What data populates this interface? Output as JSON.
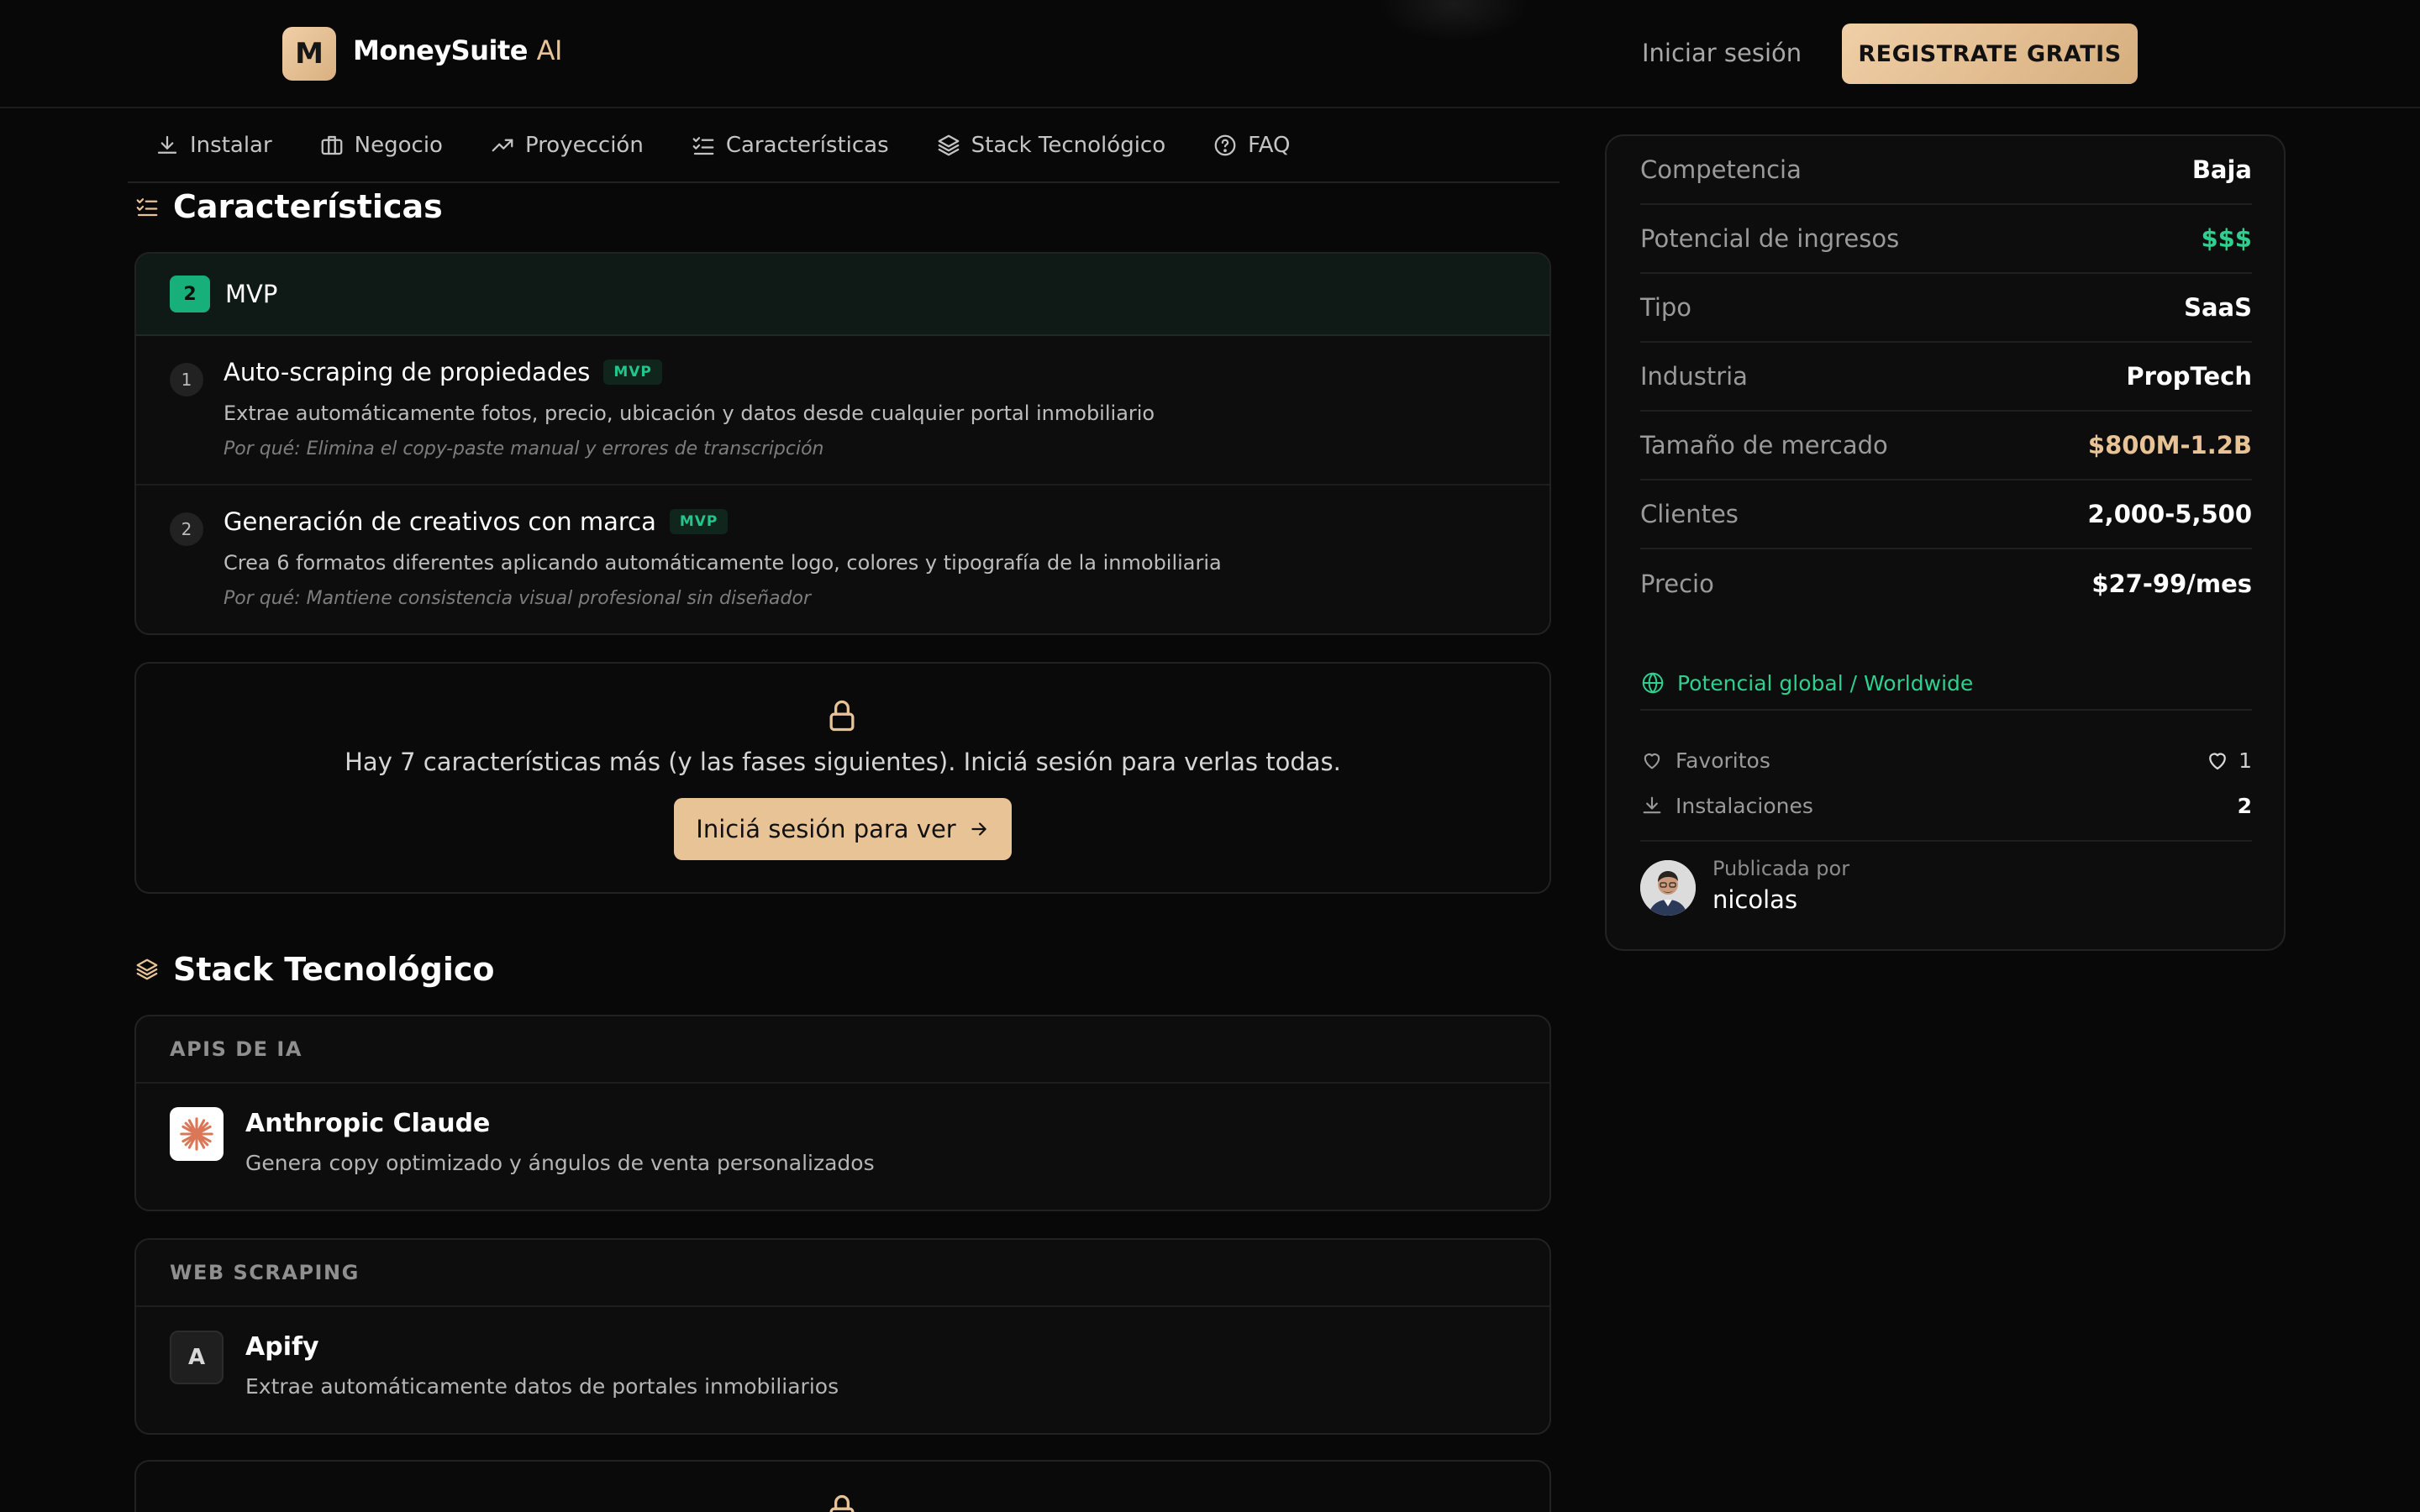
{
  "header": {
    "logo_letter": "M",
    "brand": "MoneySuite",
    "brand_suffix": "AI",
    "login": "Iniciar sesión",
    "register": "REGISTRATE GRATIS"
  },
  "nav": {
    "items": [
      {
        "label": "Instalar",
        "icon": "download-icon"
      },
      {
        "label": "Negocio",
        "icon": "briefcase-icon"
      },
      {
        "label": "Proyección",
        "icon": "trending-up-icon"
      },
      {
        "label": "Características",
        "icon": "checklist-icon"
      },
      {
        "label": "Stack Tecnológico",
        "icon": "layers-icon"
      },
      {
        "label": "FAQ",
        "icon": "help-circle-icon"
      }
    ]
  },
  "features": {
    "title": "Características",
    "phase_number": "2",
    "phase_label": "MVP",
    "items": [
      {
        "num": "1",
        "title": "Auto-scraping de propiedades",
        "badge": "MVP",
        "desc": "Extrae automáticamente fotos, precio, ubicación y datos desde cualquier portal inmobiliario",
        "why": "Por qué: Elimina el copy-paste manual y errores de transcripción"
      },
      {
        "num": "2",
        "title": "Generación de creativos con marca",
        "badge": "MVP",
        "desc": "Crea 6 formatos diferentes aplicando automáticamente logo, colores y tipografía de la inmobiliaria",
        "why": "Por qué: Mantiene consistencia visual profesional sin diseñador"
      }
    ],
    "locked_text": "Hay 7 características más (y las fases siguientes). Iniciá sesión para verlas todas.",
    "locked_button": "Iniciá sesión para ver"
  },
  "stack": {
    "title": "Stack Tecnológico",
    "groups": [
      {
        "category": "APIS DE IA",
        "name": "Anthropic Claude",
        "desc": "Genera copy optimizado y ángulos de venta personalizados",
        "logo": "claude-logo-icon"
      },
      {
        "category": "WEB SCRAPING",
        "name": "Apify",
        "desc": "Extrae automáticamente datos de portales inmobiliarios",
        "logo_letter": "A"
      }
    ]
  },
  "sidebar": {
    "stats": [
      {
        "label": "Competencia",
        "value": "Baja",
        "tone": "white"
      },
      {
        "label": "Potencial de ingresos",
        "value": "$$$",
        "tone": "green"
      },
      {
        "label": "Tipo",
        "value": "SaaS",
        "tone": "white"
      },
      {
        "label": "Industria",
        "value": "PropTech",
        "tone": "white"
      },
      {
        "label": "Tamaño de mercado",
        "value": "$800M-1.2B",
        "tone": "gold"
      },
      {
        "label": "Clientes",
        "value": "2,000-5,500",
        "tone": "white"
      },
      {
        "label": "Precio",
        "value": "$27-99/mes",
        "tone": "white"
      }
    ],
    "global": "Potencial global / Worldwide",
    "favorites_label": "Favoritos",
    "favorites_count": "1",
    "installs_label": "Instalaciones",
    "installs_count": "2",
    "published_by": "Publicada por",
    "author": "nicolas"
  },
  "colors": {
    "accent_gold": "#e8c395",
    "accent_green": "#2fd08f",
    "background": "#080808"
  }
}
